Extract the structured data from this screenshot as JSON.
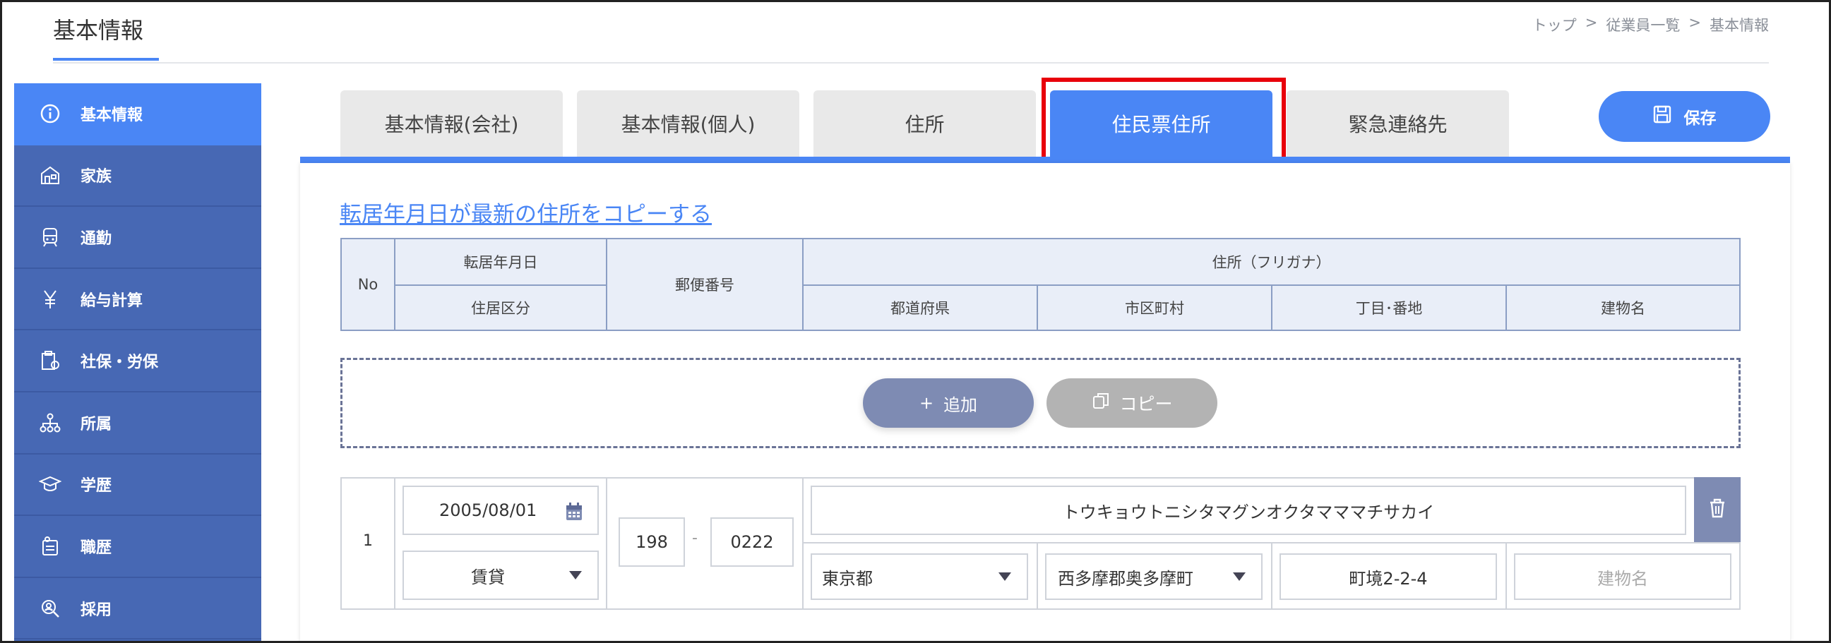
{
  "header": {
    "title": "基本情報",
    "breadcrumb": [
      "トップ",
      ">",
      "従業員一覧",
      ">",
      "基本情報"
    ]
  },
  "sidebar": {
    "items": [
      {
        "label": "基本情報",
        "icon": "info-icon",
        "active": true
      },
      {
        "label": "家族",
        "icon": "house-icon",
        "active": false
      },
      {
        "label": "通勤",
        "icon": "train-icon",
        "active": false
      },
      {
        "label": "給与計算",
        "icon": "yen-icon",
        "active": false
      },
      {
        "label": "社保・労保",
        "icon": "insurance-icon",
        "active": false
      },
      {
        "label": "所属",
        "icon": "org-chart-icon",
        "active": false
      },
      {
        "label": "学歴",
        "icon": "graduation-cap-icon",
        "active": false
      },
      {
        "label": "職歴",
        "icon": "career-icon",
        "active": false
      },
      {
        "label": "採用",
        "icon": "recruit-search-icon",
        "active": false
      }
    ]
  },
  "tabs": [
    {
      "label": "基本情報(会社)",
      "active": false
    },
    {
      "label": "基本情報(個人)",
      "active": false
    },
    {
      "label": "住所",
      "active": false
    },
    {
      "label": "住民票住所",
      "active": true
    },
    {
      "label": "緊急連絡先",
      "active": false
    }
  ],
  "toolbar": {
    "save_label": "保存"
  },
  "content": {
    "copy_link": "転居年月日が最新の住所をコピーする",
    "table_header": {
      "no": "No",
      "move_date": "転居年月日",
      "residence_type": "住居区分",
      "postal_code": "郵便番号",
      "address_kana": "住所（フリガナ）",
      "prefecture": "都道府県",
      "city": "市区町村",
      "block": "丁目･番地",
      "building": "建物名"
    },
    "actions": {
      "add_label": "追加",
      "add_prefix": "+",
      "copy_label": "コピー"
    },
    "rows": [
      {
        "no": "1",
        "move_date": "2005/08/01",
        "residence_type": "賃貸",
        "postal_code_1": "198",
        "postal_sep": "-",
        "postal_code_2": "0222",
        "address_kana": "トウキョウトニシタマグンオクタマママチサカイ",
        "prefecture": "東京都",
        "city": "西多摩郡奥多摩町",
        "block": "町境2-2-4",
        "building_placeholder": "建物名"
      }
    ]
  },
  "colors": {
    "accent": "#4a86f5",
    "sidebar": "#4768b4",
    "highlight": "#e8000b",
    "button_secondary": "#7e8bb3"
  }
}
